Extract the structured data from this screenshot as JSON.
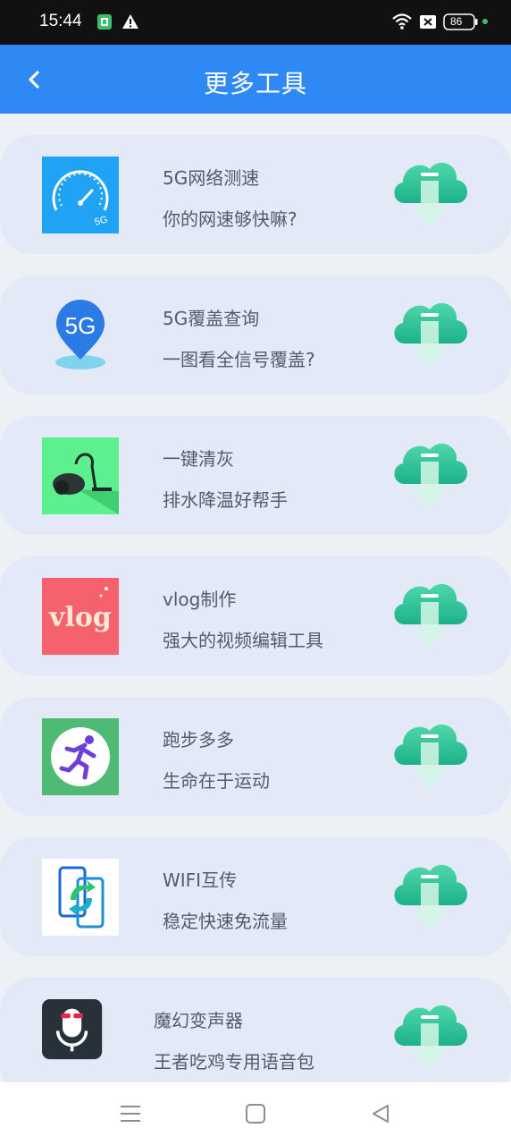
{
  "status_bar": {
    "time": "15:44",
    "battery": "86"
  },
  "header": {
    "title": "更多工具"
  },
  "tools": [
    {
      "name": "5G网络测速",
      "desc": "你的网速够快嘛?",
      "icon": "speedometer-5g-icon"
    },
    {
      "name": "5G覆盖查询",
      "desc": "一图看全信号覆盖?",
      "icon": "5g-map-pin-icon"
    },
    {
      "name": "一键清灰",
      "desc": "排水降温好帮手",
      "icon": "vacuum-cleaner-icon"
    },
    {
      "name": "vlog制作",
      "desc": "强大的视频编辑工具",
      "icon": "vlog-icon"
    },
    {
      "name": "跑步多多",
      "desc": "生命在于运动",
      "icon": "runner-icon"
    },
    {
      "name": "WIFI互传",
      "desc": "稳定快速免流量",
      "icon": "phone-transfer-icon"
    },
    {
      "name": "魔幻变声器",
      "desc": "王者吃鸡专用语音包",
      "icon": "voice-changer-icon"
    }
  ],
  "colors": {
    "header": "#2f89f5",
    "card": "#e3e9f7",
    "download_top": "#45d4a4",
    "download_bottom": "#1fb38a"
  }
}
